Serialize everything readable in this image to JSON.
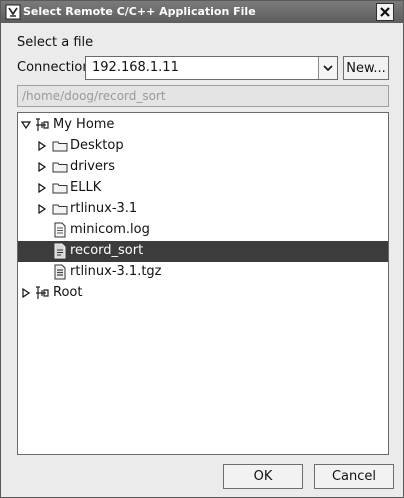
{
  "window": {
    "title": "Select Remote C/C++ Application File"
  },
  "form": {
    "heading": "Select a file",
    "connection_label": "Connection:",
    "connection_value": "192.168.1.11",
    "new_button": "New...",
    "path_value": "/home/doog/record_sort"
  },
  "tree": {
    "items": [
      {
        "label": "My Home",
        "kind": "home",
        "expanded": true
      },
      {
        "label": "Desktop",
        "kind": "folder"
      },
      {
        "label": "drivers",
        "kind": "folder"
      },
      {
        "label": "ELLK",
        "kind": "folder"
      },
      {
        "label": "rtlinux-3.1",
        "kind": "folder"
      },
      {
        "label": "minicom.log",
        "kind": "file"
      },
      {
        "label": "record_sort",
        "kind": "executable",
        "selected": true
      },
      {
        "label": "rtlinux-3.1.tgz",
        "kind": "archive"
      },
      {
        "label": "Root",
        "kind": "root",
        "expanded": false
      }
    ]
  },
  "buttons": {
    "ok": "OK",
    "cancel": "Cancel"
  },
  "colors": {
    "titlebar": "#636363",
    "selection": "#3c3c3c",
    "dialog": "#ebebeb"
  },
  "icons": {
    "window": "app-icon",
    "close": "close-icon",
    "dropdown": "chevron-down-icon",
    "folder": "folder-icon",
    "file": "file-icon",
    "home": "home-icon",
    "root": "root-icon"
  }
}
